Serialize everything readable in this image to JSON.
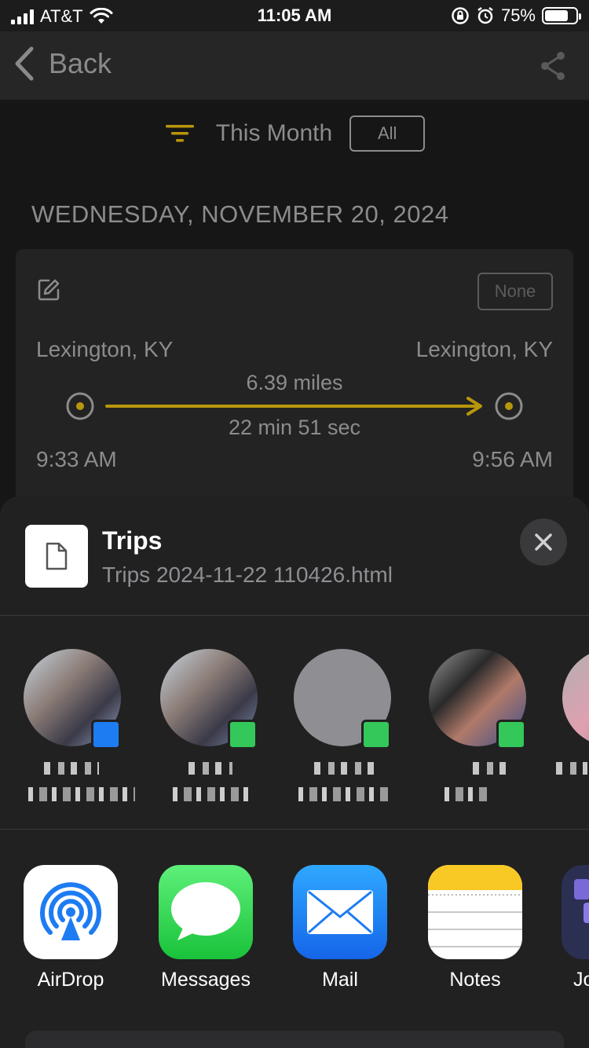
{
  "status_bar": {
    "carrier": "AT&T",
    "time": "11:05 AM",
    "battery": "75%",
    "battery_level": 0.75
  },
  "nav": {
    "back_label": "Back"
  },
  "filter": {
    "label": "This Month",
    "all_button": "All"
  },
  "date_heading": "WEDNESDAY, NOVEMBER 20, 2024",
  "trip": {
    "badge": "None",
    "from_city": "Lexington, KY",
    "to_city": "Lexington, KY",
    "distance": "6.39 miles",
    "duration": "22 min 51 sec",
    "start_time": "9:33 AM",
    "end_time": "9:56 AM"
  },
  "share_sheet": {
    "title": "Trips",
    "filename": "Trips 2024-11-22 110426.html",
    "apps": [
      {
        "label": "AirDrop",
        "icon": "airdrop-icon"
      },
      {
        "label": "Messages",
        "icon": "messages-icon"
      },
      {
        "label": "Mail",
        "icon": "mail-icon"
      },
      {
        "label": "Notes",
        "icon": "notes-icon"
      },
      {
        "label": "Jo",
        "icon": "app-icon"
      }
    ]
  },
  "colors": {
    "accent_gold": "#b8960c",
    "muted_text": "#8c8c8c",
    "ios_blue": "#1e7cf2",
    "ios_green": "#34c759"
  }
}
